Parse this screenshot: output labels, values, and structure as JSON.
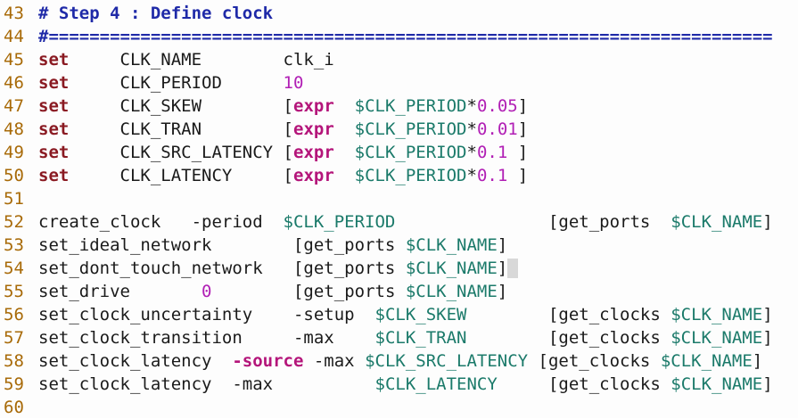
{
  "colors": {
    "line_number": "#a86a08",
    "comment": "#1f2aa8",
    "keyword": "#8a1a22",
    "expr_keyword": "#b4157a",
    "variable": "#1b7a6a",
    "number": "#b11fb5",
    "text": "#1a1a1a",
    "background": "#fdfdfd"
  },
  "lines": [
    {
      "num": "43",
      "tokens": [
        {
          "t": "c",
          "v": "# Step 4 : Define clock"
        }
      ]
    },
    {
      "num": "44",
      "tokens": [
        {
          "t": "c",
          "v": "#======================================================================="
        }
      ]
    },
    {
      "num": "45",
      "tokens": [
        {
          "t": "k",
          "v": "set"
        },
        {
          "t": "p",
          "v": "     CLK_NAME        clk_i"
        }
      ]
    },
    {
      "num": "46",
      "tokens": [
        {
          "t": "k",
          "v": "set"
        },
        {
          "t": "p",
          "v": "     CLK_PERIOD      "
        },
        {
          "t": "n",
          "v": "10"
        }
      ]
    },
    {
      "num": "47",
      "tokens": [
        {
          "t": "k",
          "v": "set"
        },
        {
          "t": "p",
          "v": "     CLK_SKEW        ["
        },
        {
          "t": "e",
          "v": "expr"
        },
        {
          "t": "p",
          "v": "  "
        },
        {
          "t": "v",
          "v": "$CLK_PERIOD"
        },
        {
          "t": "p",
          "v": "*"
        },
        {
          "t": "n",
          "v": "0.05"
        },
        {
          "t": "p",
          "v": "]"
        }
      ]
    },
    {
      "num": "48",
      "tokens": [
        {
          "t": "k",
          "v": "set"
        },
        {
          "t": "p",
          "v": "     CLK_TRAN        ["
        },
        {
          "t": "e",
          "v": "expr"
        },
        {
          "t": "p",
          "v": "  "
        },
        {
          "t": "v",
          "v": "$CLK_PERIOD"
        },
        {
          "t": "p",
          "v": "*"
        },
        {
          "t": "n",
          "v": "0.01"
        },
        {
          "t": "p",
          "v": "]"
        }
      ]
    },
    {
      "num": "49",
      "tokens": [
        {
          "t": "k",
          "v": "set"
        },
        {
          "t": "p",
          "v": "     CLK_SRC_LATENCY ["
        },
        {
          "t": "e",
          "v": "expr"
        },
        {
          "t": "p",
          "v": "  "
        },
        {
          "t": "v",
          "v": "$CLK_PERIOD"
        },
        {
          "t": "p",
          "v": "*"
        },
        {
          "t": "n",
          "v": "0.1"
        },
        {
          "t": "p",
          "v": " ]"
        }
      ]
    },
    {
      "num": "50",
      "tokens": [
        {
          "t": "k",
          "v": "set"
        },
        {
          "t": "p",
          "v": "     CLK_LATENCY     ["
        },
        {
          "t": "e",
          "v": "expr"
        },
        {
          "t": "p",
          "v": "  "
        },
        {
          "t": "v",
          "v": "$CLK_PERIOD"
        },
        {
          "t": "p",
          "v": "*"
        },
        {
          "t": "n",
          "v": "0.1"
        },
        {
          "t": "p",
          "v": " ]"
        }
      ]
    },
    {
      "num": "51",
      "tokens": []
    },
    {
      "num": "52",
      "tokens": [
        {
          "t": "p",
          "v": "create_clock   -period  "
        },
        {
          "t": "v",
          "v": "$CLK_PERIOD"
        },
        {
          "t": "p",
          "v": "               [get_ports  "
        },
        {
          "t": "v",
          "v": "$CLK_NAME"
        },
        {
          "t": "p",
          "v": "]"
        }
      ]
    },
    {
      "num": "53",
      "tokens": [
        {
          "t": "p",
          "v": "set_ideal_network        [get_ports "
        },
        {
          "t": "v",
          "v": "$CLK_NAME"
        },
        {
          "t": "p",
          "v": "]"
        }
      ]
    },
    {
      "num": "54",
      "tokens": [
        {
          "t": "p",
          "v": "set_dont_touch_network   [get_ports "
        },
        {
          "t": "v",
          "v": "$CLK_NAME"
        },
        {
          "t": "p",
          "v": "]"
        },
        {
          "t": "cur",
          "v": " "
        }
      ]
    },
    {
      "num": "55",
      "tokens": [
        {
          "t": "p",
          "v": "set_drive       "
        },
        {
          "t": "n",
          "v": "0"
        },
        {
          "t": "p",
          "v": "        [get_ports "
        },
        {
          "t": "v",
          "v": "$CLK_NAME"
        },
        {
          "t": "p",
          "v": "]"
        }
      ]
    },
    {
      "num": "56",
      "tokens": [
        {
          "t": "p",
          "v": "set_clock_uncertainty    -setup  "
        },
        {
          "t": "v",
          "v": "$CLK_SKEW"
        },
        {
          "t": "p",
          "v": "        [get_clocks "
        },
        {
          "t": "v",
          "v": "$CLK_NAME"
        },
        {
          "t": "p",
          "v": "]"
        }
      ]
    },
    {
      "num": "57",
      "tokens": [
        {
          "t": "p",
          "v": "set_clock_transition     -max    "
        },
        {
          "t": "v",
          "v": "$CLK_TRAN"
        },
        {
          "t": "p",
          "v": "        [get_clocks "
        },
        {
          "t": "v",
          "v": "$CLK_NAME"
        },
        {
          "t": "p",
          "v": "]"
        }
      ]
    },
    {
      "num": "58",
      "tokens": [
        {
          "t": "p",
          "v": "set_clock_latency  "
        },
        {
          "t": "e",
          "v": "-source"
        },
        {
          "t": "p",
          "v": " -max "
        },
        {
          "t": "v",
          "v": "$CLK_SRC_LATENCY"
        },
        {
          "t": "p",
          "v": " [get_clocks "
        },
        {
          "t": "v",
          "v": "$CLK_NAME"
        },
        {
          "t": "p",
          "v": "]"
        }
      ]
    },
    {
      "num": "59",
      "tokens": [
        {
          "t": "p",
          "v": "set_clock_latency  -max          "
        },
        {
          "t": "v",
          "v": "$CLK_LATENCY"
        },
        {
          "t": "p",
          "v": "     [get_clocks "
        },
        {
          "t": "v",
          "v": "$CLK_NAME"
        },
        {
          "t": "p",
          "v": "]"
        }
      ]
    },
    {
      "num": "60",
      "tokens": []
    }
  ]
}
